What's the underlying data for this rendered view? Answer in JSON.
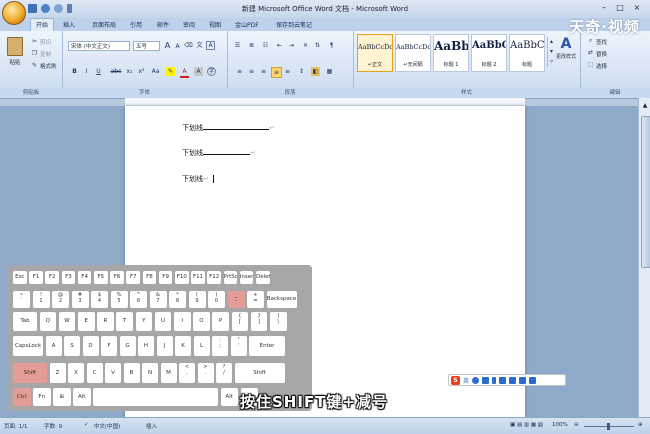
{
  "window": {
    "title": "新建 Microsoft Office Word 文档 - Microsoft Word",
    "watermark": "天奇·视频",
    "controls": [
      "–",
      "□",
      "×"
    ]
  },
  "quick_access": [
    "save-icon",
    "undo-icon",
    "redo-icon",
    "dropdown-icon"
  ],
  "tabs": [
    "开始",
    "插入",
    "页面布局",
    "引用",
    "邮件",
    "审阅",
    "视图",
    "金山PDF",
    "保存到云笔记"
  ],
  "active_tab": "开始",
  "ribbon": {
    "clipboard": {
      "label": "剪贴板",
      "paste": "粘贴",
      "cut": "剪切",
      "copy": "复制",
      "format_painter": "格式刷"
    },
    "font": {
      "label": "字体",
      "font_name": "宋体 (中文正文)",
      "font_size": "五号",
      "buttons": [
        "B",
        "I",
        "U",
        "abc",
        "x₂",
        "x²",
        "Aa",
        "A"
      ]
    },
    "paragraph": {
      "label": "段落"
    },
    "styles": {
      "label": "样式",
      "items": [
        {
          "preview": "AaBbCcDdI",
          "name": "↵正文",
          "selected": true
        },
        {
          "preview": "AaBbCcDd",
          "name": "↵无间隔",
          "selected": false
        },
        {
          "preview": "AaBb",
          "name": "标题 1",
          "selected": false
        },
        {
          "preview": "AaBbC",
          "name": "标题 2",
          "selected": false
        },
        {
          "preview": "AaBbC",
          "name": "标题",
          "selected": false
        }
      ],
      "change_styles": "更改样式"
    },
    "editing": {
      "label": "编辑",
      "find": "查找",
      "replace": "替换",
      "select": "选择"
    }
  },
  "document": {
    "lines": [
      "下划线",
      "下划线",
      "下划线"
    ],
    "paragraph_mark": "↵"
  },
  "keyboard": {
    "rows": [
      [
        "Esc",
        "F1",
        "F2",
        "F3",
        "F4",
        "F5",
        "F6",
        "F7",
        "F8",
        "F9",
        "F10",
        "F11",
        "F12",
        "PrtScr",
        "Insert",
        "Delete"
      ],
      [
        "~\n`",
        "!\n1",
        "@\n2",
        "#\n3",
        "$\n4",
        "%\n5",
        "^\n6",
        "&\n7",
        "*\n8",
        "(\n9",
        ")\n0",
        "_\n-",
        "+\n=",
        "Backspace"
      ],
      [
        "Tab",
        "Q",
        "W",
        "E",
        "R",
        "T",
        "Y",
        "U",
        "I",
        "O",
        "P",
        "{\n[",
        "}\n]",
        "|\n\\"
      ],
      [
        "CapsLock",
        "A",
        "S",
        "D",
        "F",
        "G",
        "H",
        "J",
        "K",
        "L",
        ":\n;",
        "\"\n'",
        "Enter"
      ],
      [
        "Shift",
        "Z",
        "X",
        "C",
        "V",
        "B",
        "N",
        "M",
        "<\n,",
        ">\n.",
        "?\n/",
        "Shift"
      ],
      [
        "Ctrl",
        "Fn",
        "⊞",
        "Alt",
        "",
        "Alt",
        "Ctrl"
      ]
    ],
    "highlighted": [
      "_\n-",
      "Shift",
      "Ctrl"
    ]
  },
  "caption": "按住SHIFT键+减号",
  "ime": {
    "logo": "S",
    "mode": "英"
  },
  "status": {
    "page": "页面: 1/1",
    "words": "字数: 9",
    "language": "中文(中国)",
    "mode": "插入",
    "zoom": "100%"
  },
  "colors": {
    "ribbon_bg": "#dbe6f4",
    "key_highlight": "#e49c96",
    "keyboard_bg": "#a7a7a9"
  }
}
